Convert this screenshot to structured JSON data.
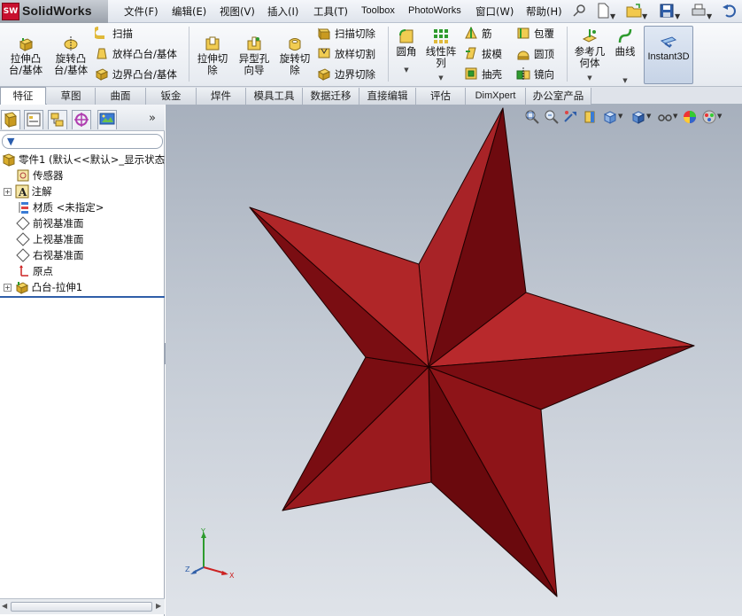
{
  "app": {
    "logo_badge": "SW",
    "name": "SolidWorks"
  },
  "menu": [
    "文件(F)",
    "编辑(E)",
    "视图(V)",
    "插入(I)",
    "工具(T)",
    "Toolbox",
    "PhotoWorks",
    "窗口(W)",
    "帮助(H)"
  ],
  "features_toolbar": {
    "extrude_boss": "拉伸凸台/基体",
    "revolve_boss": "旋转凸台/基体",
    "sweep": "扫描",
    "loft_boss": "放样凸台/基体",
    "boundary_boss": "边界凸台/基体",
    "extrude_cut": "拉伸切除",
    "hole_wizard": "异型孔向导",
    "revolve_cut": "旋转切除",
    "swept_cut": "扫描切除",
    "lofted_cut": "放样切割",
    "boundary_cut": "边界切除",
    "fillet": "圆角",
    "linear_pattern": "线性阵列",
    "rib": "筋",
    "draft": "拔模",
    "shell": "抽壳",
    "wrap": "包覆",
    "dome": "圆顶",
    "mirror": "镜向",
    "reference_geometry": "参考几何体",
    "curves": "曲线",
    "instant3d": "Instant3D"
  },
  "tabs": [
    "特征",
    "草图",
    "曲面",
    "钣金",
    "焊件",
    "模具工具",
    "数据迁移",
    "直接编辑",
    "评估",
    "DimXpert",
    "办公室产品"
  ],
  "active_tab": "特征",
  "feature_tree": {
    "root": "零件1 (默认<<默认>_显示状态",
    "items": [
      "传感器",
      "注解",
      "材质 <未指定>",
      "前视基准面",
      "上视基准面",
      "右视基准面",
      "原点",
      "凸台-拉伸1"
    ]
  },
  "triad_axes": [
    "Y",
    "Z",
    "X"
  ],
  "colors": {
    "star_face_light": "#b2282c",
    "star_face_dark": "#6e0a0f",
    "star_edge": "#1e0000",
    "viewport_top": "#a7b0bd",
    "viewport_bottom": "#dfe3e9"
  }
}
